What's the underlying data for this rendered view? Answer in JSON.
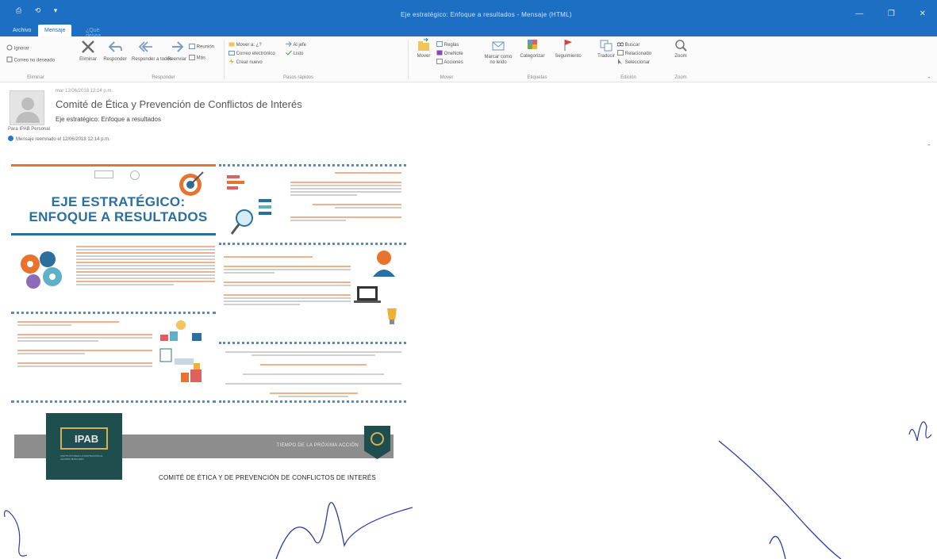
{
  "titlebar": {
    "quick_access": [
      "⎙",
      "⟲",
      "▾"
    ],
    "window_title": "Eje estratégico: Enfoque a resultados - Mensaje (HTML)",
    "controls": [
      "—",
      "❐",
      "✕"
    ]
  },
  "ribbon_tabs": [
    "Archivo",
    "Mensaje",
    "¿Qué desea hacer?"
  ],
  "ribbon": {
    "ignore": "Ignorar",
    "junk": "Correo no deseado",
    "delete": "Eliminar",
    "reply": "Responder",
    "reply_all": "Responder a todos",
    "forward": "Reenviar",
    "more": "Más",
    "meeting": "Reunión",
    "quick_steps": [
      "Mover a: ¿?",
      "Al jefe",
      "Correo electrónico",
      "Listo",
      "Crear nuevo"
    ],
    "move_items": [
      "Mover",
      "Reglas",
      "OneNote",
      "Acciones"
    ],
    "tags_items": [
      "Marcar como no leído",
      "Categorizar",
      "Seguimiento"
    ],
    "edit_items": [
      "Traducir",
      "Buscar",
      "Relacionado",
      "Seleccionar"
    ],
    "zoom": "Zoom",
    "group_labels": [
      "Eliminar",
      "Responder",
      "Pasos rápidos",
      "Mover",
      "Etiquetas",
      "Edición",
      "Zoom"
    ]
  },
  "message": {
    "date": "mar 12/06/2018 12:14 p.m.",
    "from": "Comité de Ética y Prevención de Conflictos de Interés",
    "subject": "Eje estratégico: Enfoque a resultados",
    "to": "Para   IPAB Personal",
    "note": "Mensaje reenviado el 12/06/2018 12:14 p.m."
  },
  "infographic": {
    "title_line1": "EJE ESTRATÉGICO:",
    "title_line2": "ENFOQUE A RESULTADOS"
  },
  "banner": {
    "bar_text": "TIEMPO DE LA PRÓXIMA ACCIÓN",
    "logo_text": "IPAB",
    "logo_sub": "INSTITUTO PARA LA PROTECCIÓN AL AHORRO BANCARIO",
    "committee": "COMITÉ DE ÉTICA Y DE PREVENCIÓN DE CONFLICTOS DE INTERÉS"
  },
  "colors": {
    "titlebar": "#1d6fc3",
    "accent_orange": "#e8732d",
    "title_blue": "#2a6f9e",
    "banner_dark": "#1f4e4e",
    "banner_gray": "#8d8d8d"
  }
}
